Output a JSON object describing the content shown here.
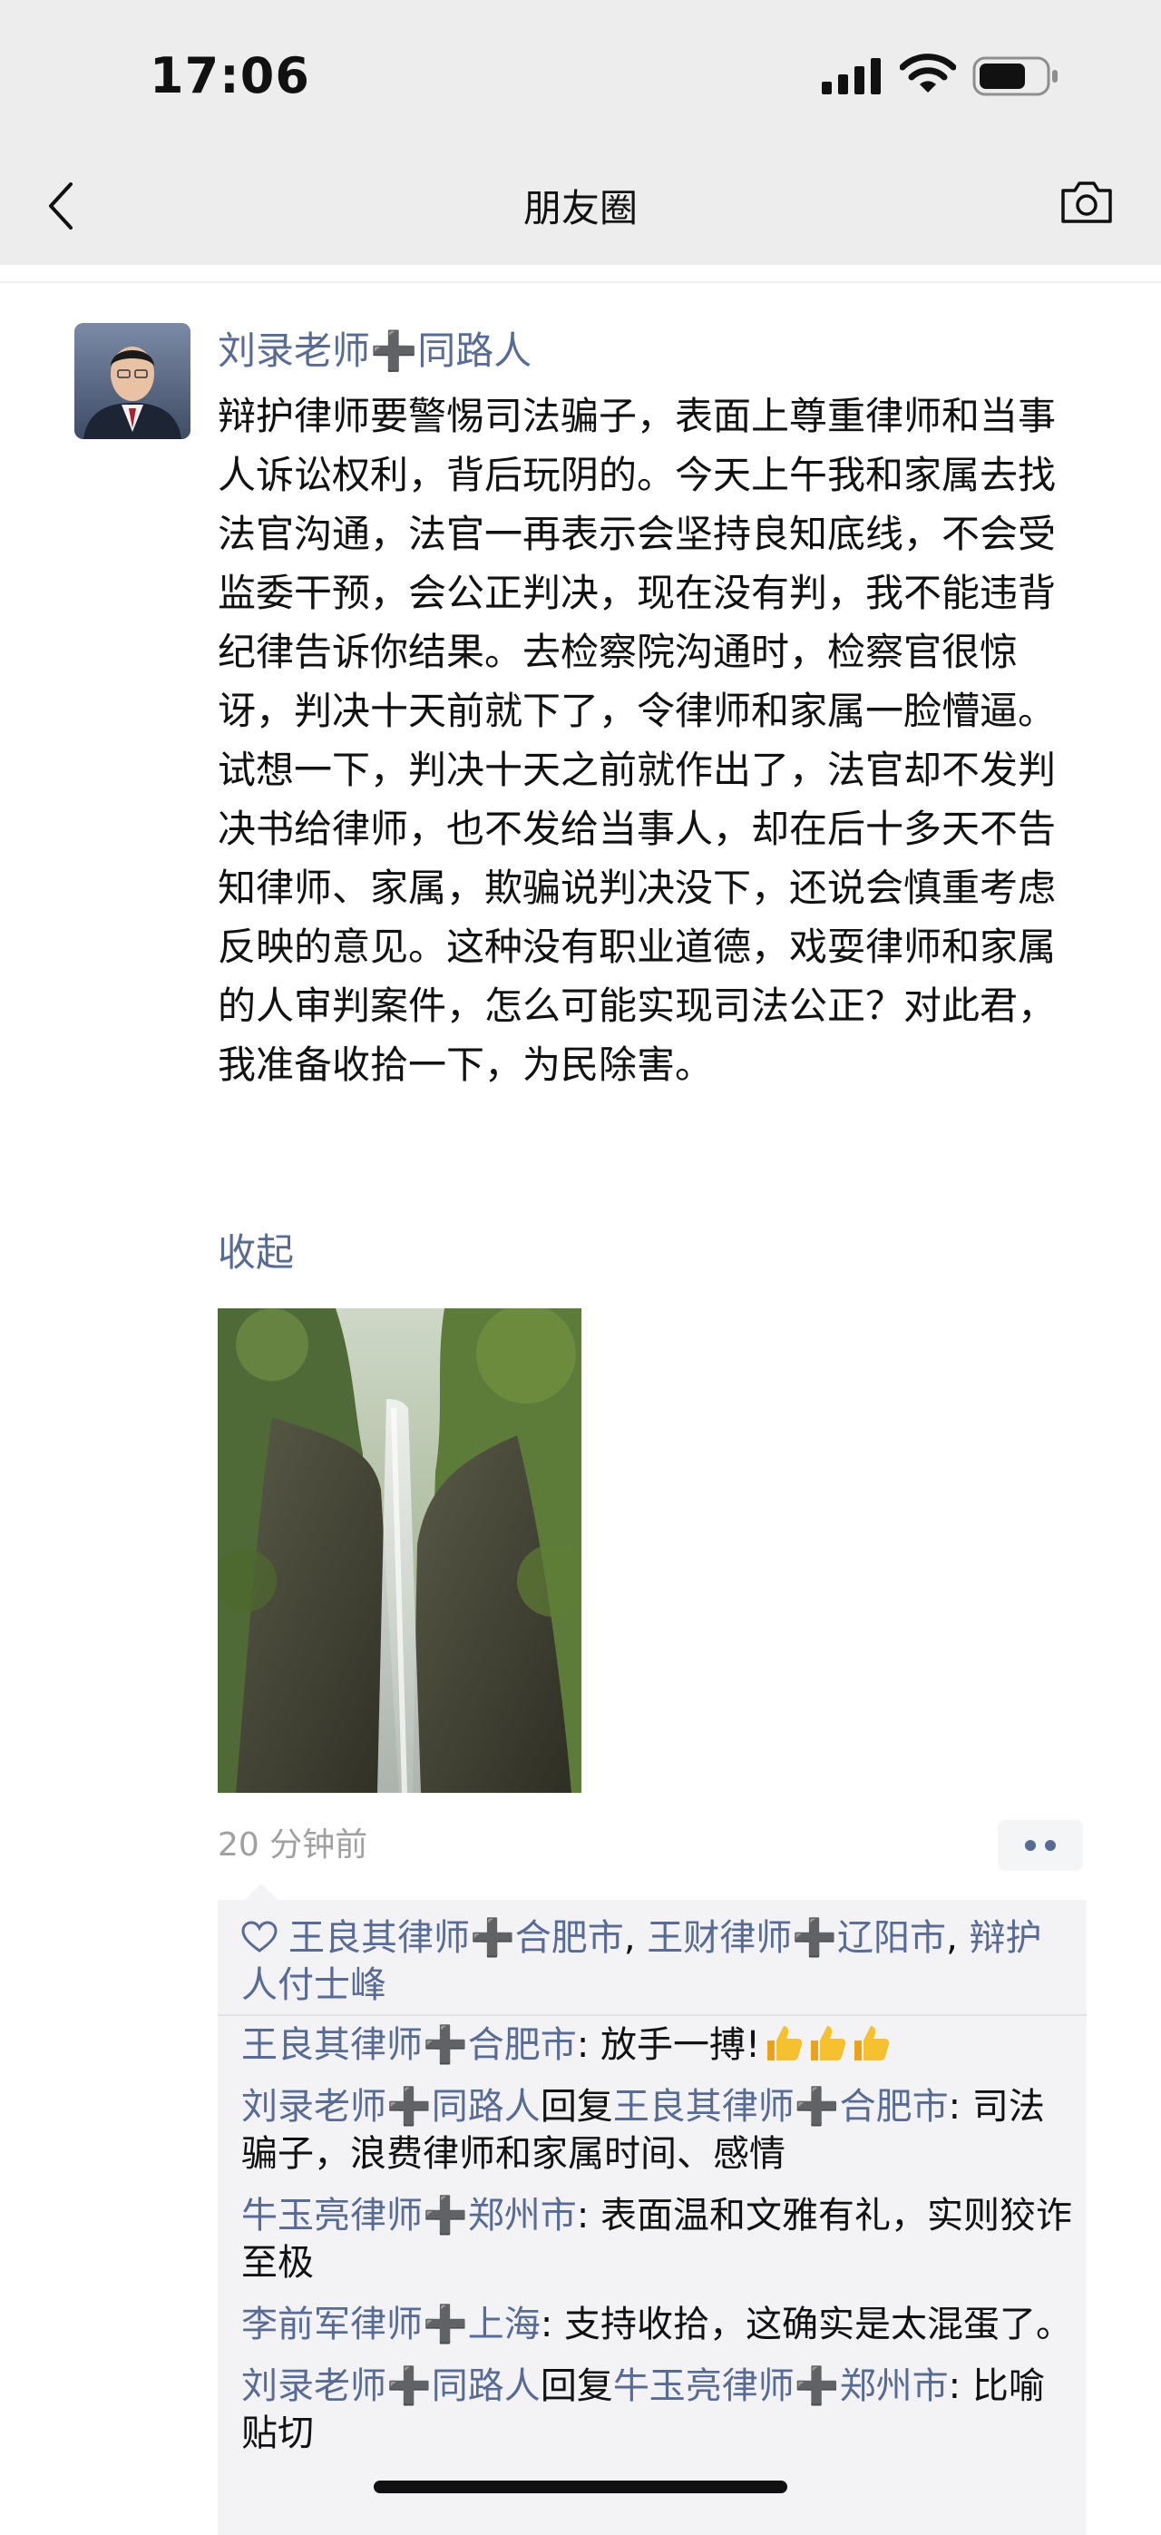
{
  "status_bar": {
    "time": "17:06"
  },
  "nav": {
    "title": "朋友圈",
    "back_icon": "chevron-left-icon",
    "camera_icon": "camera-icon"
  },
  "post": {
    "author": "刘录老师➕同路人",
    "text": "辩护律师要警惕司法骗子，表面上尊重律师和当事人诉讼权利，背后玩阴的。今天上午我和家属去找法官沟通，法官一再表示会坚持良知底线，不会受监委干预，会公正判决，现在没有判，我不能违背纪律告诉你结果。去检察院沟通时，检察官很惊讶，判决十天前就下了，令律师和家属一脸懵逼。试想一下，判决十天之前就作出了，法官却不发判决书给律师，也不发给当事人，却在后十多天不告知律师、家属，欺骗说判决没下，还说会慎重考虑反映的意见。这种没有职业道德，戏耍律师和家属的人审判案件，怎么可能实现司法公正？对此君，我准备收拾一下，为民除害。",
    "collapse_label": "收起",
    "timestamp": "20 分钟前"
  },
  "likes": {
    "icon": "heart-outline-icon",
    "names": [
      "王良其律师➕合肥市",
      "王财律师➕辽阳市",
      "辩护人付士峰"
    ],
    "separator": ", "
  },
  "comments": [
    {
      "author": "王良其律师➕合肥市",
      "reply_word": "",
      "reply_to": "",
      "sep": ": ",
      "text": "放手一搏!",
      "thumbs": 3
    },
    {
      "author": "刘录老师➕同路人",
      "reply_word": "回复",
      "reply_to": "王良其律师➕合肥市",
      "sep": ": ",
      "text": "司法骗子，浪费律师和家属时间、感情",
      "thumbs": 0
    },
    {
      "author": "牛玉亮律师➕郑州市",
      "reply_word": "",
      "reply_to": "",
      "sep": ": ",
      "text": "表面温和文雅有礼，实则狡诈至极",
      "thumbs": 0
    },
    {
      "author": "李前军律师➕上海",
      "reply_word": "",
      "reply_to": "",
      "sep": ": ",
      "text": "支持收拾，这确实是太混蛋了。",
      "thumbs": 0
    },
    {
      "author": "刘录老师➕同路人",
      "reply_word": "回复",
      "reply_to": "牛玉亮律师➕郑州市",
      "sep": ": ",
      "text": "比喻贴切",
      "thumbs": 0
    }
  ],
  "colors": {
    "link": "#576b95",
    "header_bg": "#ededed",
    "panel_bg": "#f3f3f5",
    "timestamp": "#a0a0a0"
  }
}
